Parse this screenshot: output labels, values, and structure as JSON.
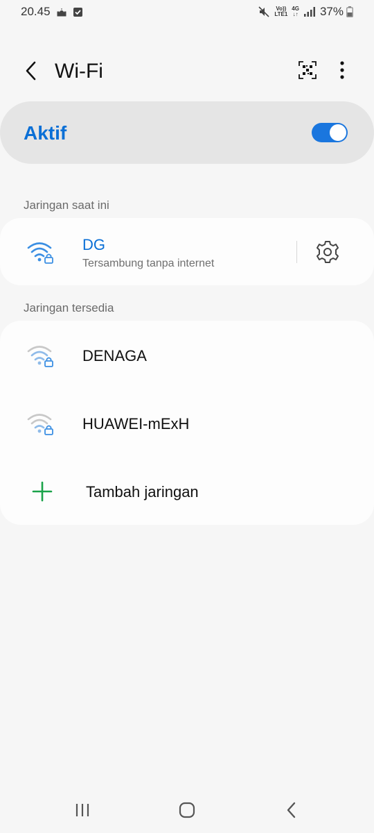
{
  "status_bar": {
    "time": "20.45",
    "volte_top": "Vo))",
    "volte_bottom": "LTE1",
    "network_type": "4G",
    "battery_percent": "37%"
  },
  "header": {
    "title": "Wi-Fi"
  },
  "master_toggle": {
    "label": "Aktif",
    "on": true
  },
  "current_section": {
    "label": "Jaringan saat ini",
    "network": {
      "name": "DG",
      "status": "Tersambung tanpa internet"
    }
  },
  "available_section": {
    "label": "Jaringan tersedia",
    "networks": [
      {
        "name": "DENAGA"
      },
      {
        "name": "HUAWEI-mExH"
      }
    ],
    "add_label": "Tambah jaringan"
  },
  "colors": {
    "accent": "#0a6fd6",
    "toggle_on": "#1a76de",
    "add_icon": "#1aa34a",
    "wifi_connected": "#3b8fe3",
    "wifi_weak": "#8fbbe9"
  },
  "icons": {
    "back": "chevron-left-icon",
    "qr": "qr-code-icon",
    "more": "more-vertical-icon",
    "wifi": "wifi-lock-icon",
    "settings": "gear-icon",
    "add": "plus-icon"
  }
}
